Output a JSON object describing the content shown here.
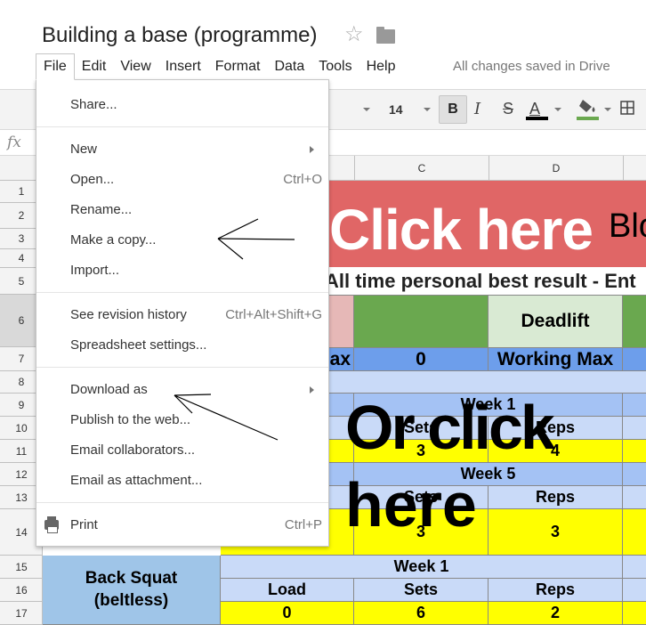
{
  "header": {
    "title": "Building a base (programme)",
    "saved_status": "All changes saved in Drive",
    "star_icon": "star-outline-icon",
    "folder_icon": "folder-icon"
  },
  "menubar": [
    "File",
    "Edit",
    "View",
    "Insert",
    "Format",
    "Data",
    "Tools",
    "Help"
  ],
  "toolbar": {
    "font_size": "14",
    "bold": "B",
    "italic": "I",
    "strikethrough": "S",
    "text_color": "A",
    "text_color_value": "#000000",
    "fill_color_value": "#6aa84f"
  },
  "formula_bar": {
    "icon": "fx"
  },
  "columns": [
    "C",
    "D"
  ],
  "rows": [
    "1",
    "2",
    "3",
    "4",
    "5",
    "6",
    "7",
    "8",
    "9",
    "10",
    "11",
    "12",
    "13",
    "14",
    "15",
    "16",
    "17"
  ],
  "file_menu": {
    "items": [
      {
        "label": "Share...",
        "shortcut": ""
      },
      {
        "label": "New",
        "shortcut": "",
        "submenu": true
      },
      {
        "label": "Open...",
        "shortcut": "Ctrl+O"
      },
      {
        "label": "Rename...",
        "shortcut": ""
      },
      {
        "label": "Make a copy...",
        "shortcut": ""
      },
      {
        "label": "Import...",
        "shortcut": ""
      },
      {
        "label": "See revision history",
        "shortcut": "Ctrl+Alt+Shift+G"
      },
      {
        "label": "Spreadsheet settings...",
        "shortcut": ""
      },
      {
        "label": "Download as",
        "shortcut": "",
        "submenu": true
      },
      {
        "label": "Publish to the web...",
        "shortcut": ""
      },
      {
        "label": "Email collaborators...",
        "shortcut": ""
      },
      {
        "label": "Email as attachment...",
        "shortcut": ""
      },
      {
        "label": "Print",
        "shortcut": "Ctrl+P"
      }
    ]
  },
  "sheet": {
    "banner_text": "Click here",
    "banner_side": "Blo",
    "personal_best": "All time personal best result - Ent",
    "row6": {
      "d": "Deadlift"
    },
    "row7": {
      "b": "ax",
      "c": "0",
      "d": "Working Max"
    },
    "row9": {
      "c": "Week 1"
    },
    "row10": {
      "c": "Sets",
      "d": "Reps"
    },
    "row11": {
      "c": "3",
      "d": "4"
    },
    "row12": {
      "c": "Week 5"
    },
    "row13": {
      "c": "Sets",
      "d": "Reps"
    },
    "row14": {
      "c": "3",
      "d": "3"
    },
    "row15_17_label": "Back Squat\n(beltless)",
    "row15": {
      "c": "Week 1"
    },
    "row16": {
      "b": "Load",
      "c": "Sets",
      "d": "Reps"
    },
    "row17": {
      "b": "0",
      "c": "6",
      "d": "2"
    }
  },
  "overlay": {
    "line1": "Or click",
    "line2": "here"
  },
  "colors": {
    "banner": "#e06666",
    "green": "#6aa84f",
    "light_green": "#d9ead3",
    "pink": "#e6b8b7",
    "blue": "#6d9eeb",
    "light_blue": "#c9daf8",
    "mid_blue": "#a4c2f4",
    "label_blue": "#9fc5e8",
    "yellow": "#ffff00"
  }
}
